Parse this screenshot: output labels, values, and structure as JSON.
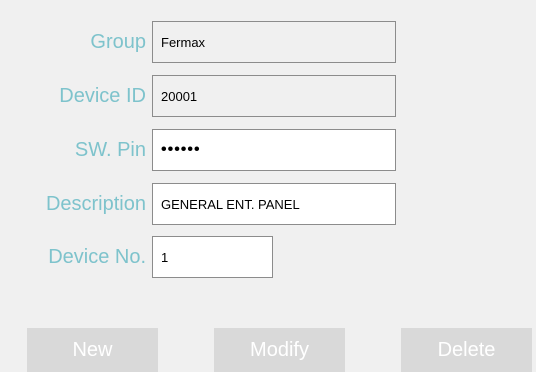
{
  "form": {
    "group": {
      "label": "Group",
      "value": "Fermax"
    },
    "device_id": {
      "label": "Device ID",
      "value": "20001"
    },
    "sw_pin": {
      "label": "SW. Pin",
      "value": "••••••"
    },
    "description": {
      "label": "Description",
      "value": "GENERAL ENT. PANEL"
    },
    "device_no": {
      "label": "Device No.",
      "value": "1"
    }
  },
  "buttons": {
    "new": "New",
    "modify": "Modify",
    "delete": "Delete"
  },
  "colors": {
    "label": "#7ec3cc",
    "background": "#f0f0f0",
    "button_bg": "#d9d9d9",
    "button_text": "#ffffff",
    "field_border": "#8c8c8c"
  }
}
